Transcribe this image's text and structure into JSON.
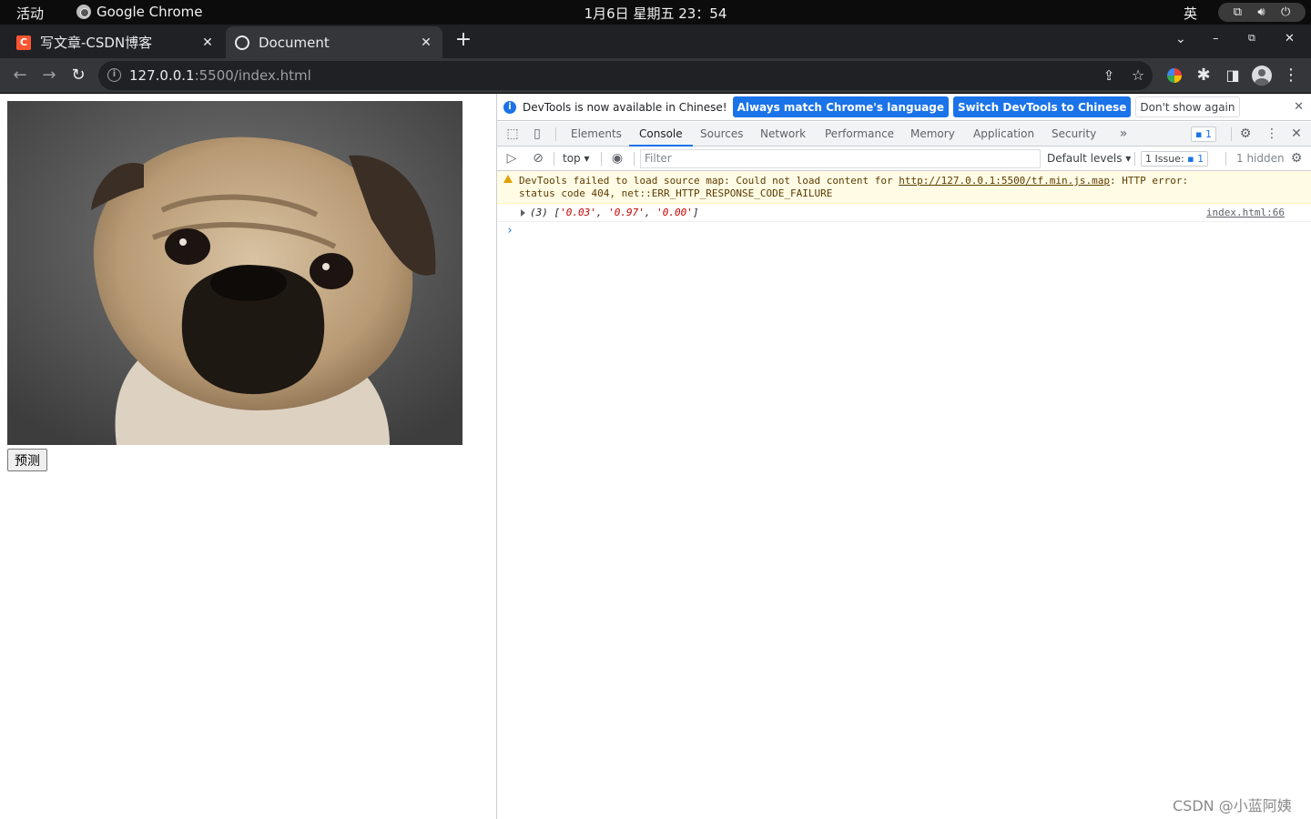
{
  "gnome_bar": {
    "activities": "活动",
    "app_name": "Google Chrome",
    "clock": "1月6日 星期五 23：54",
    "input_method": "英"
  },
  "tabs": [
    {
      "title": "写文章-CSDN博客",
      "favicon": "csdn-icon",
      "favicon_text": "C",
      "active": false
    },
    {
      "title": "Document",
      "favicon": "globe-icon",
      "active": true
    }
  ],
  "toolbar": {
    "url_host": "127.0.0.1",
    "url_path": ":5500/index.html"
  },
  "page": {
    "image_subject": "pug",
    "predict_button": "预测"
  },
  "devtools": {
    "infobar": {
      "message": "DevTools is now available in Chinese!",
      "btn_match": "Always match Chrome's language",
      "btn_switch": "Switch DevTools to Chinese",
      "btn_dismiss": "Don't show again"
    },
    "tabs": [
      "Elements",
      "Console",
      "Sources",
      "Network",
      "Performance",
      "Memory",
      "Application",
      "Security"
    ],
    "active_tab": "Console",
    "messages_badge": "1",
    "console_toolbar": {
      "context": "top",
      "filter_placeholder": "Filter",
      "levels": "Default levels",
      "issues_label": "1 Issue:",
      "issues_count": "1",
      "hidden": "1 hidden"
    },
    "warning": {
      "text_before": "DevTools failed to load source map: Could not load content for ",
      "link": "http://127.0.0.1:5500/tf.min.js.map",
      "text_after": ": HTTP error:",
      "line2": "status code 404, net::ERR_HTTP_RESPONSE_CODE_FAILURE"
    },
    "log": {
      "prefix": "(3) [",
      "values": [
        "'0.03'",
        "'0.97'",
        "'0.00'"
      ],
      "source": "index.html:66"
    },
    "prompt": "›"
  },
  "watermark": "CSDN @小蓝阿姨",
  "colors": {
    "accent": "#1a73e8",
    "warning_bg": "#fffbe5",
    "chrome_dark": "#35363a"
  }
}
